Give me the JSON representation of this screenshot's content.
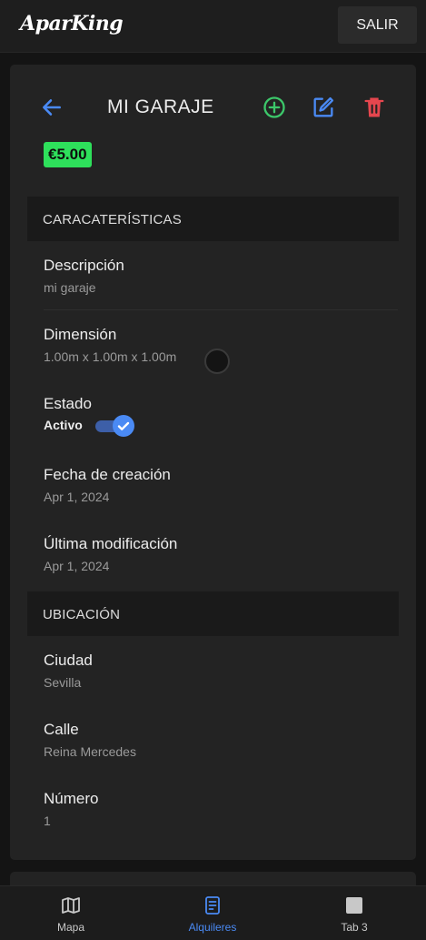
{
  "app": {
    "logo": "AparKing",
    "exit_label": "SALIR"
  },
  "header": {
    "title": "MI GARAJE"
  },
  "price": "€5.00",
  "colors": {
    "accent": "#4a8af4",
    "success": "#2ee05b",
    "danger": "#e5464e",
    "add": "#3cc76a"
  },
  "icons": {
    "back": "arrow-left-icon",
    "add": "plus-circle-icon",
    "edit": "edit-icon",
    "delete": "trash-icon"
  },
  "sections": {
    "characteristics": "CARACATERÍSTICAS",
    "location": "UBICACIÓN"
  },
  "characteristics": {
    "description": {
      "label": "Descripción",
      "value": "mi garaje"
    },
    "dimension": {
      "label": "Dimensión",
      "value": "1.00m x 1.00m x 1.00m"
    },
    "status": {
      "label": "Estado",
      "value": "Activo",
      "enabled": true
    },
    "created": {
      "label": "Fecha de creación",
      "value": "Apr 1, 2024"
    },
    "modified": {
      "label": "Última modificación",
      "value": "Apr 1, 2024"
    }
  },
  "location": {
    "city": {
      "label": "Ciudad",
      "value": "Sevilla"
    },
    "street": {
      "label": "Calle",
      "value": "Reina Mercedes"
    },
    "number": {
      "label": "Número",
      "value": "1"
    }
  },
  "tabs": [
    {
      "label": "Mapa",
      "icon": "map-icon",
      "active": false
    },
    {
      "label": "Alquileres",
      "icon": "document-icon",
      "active": true
    },
    {
      "label": "Tab 3",
      "icon": "square-icon",
      "active": false
    }
  ]
}
